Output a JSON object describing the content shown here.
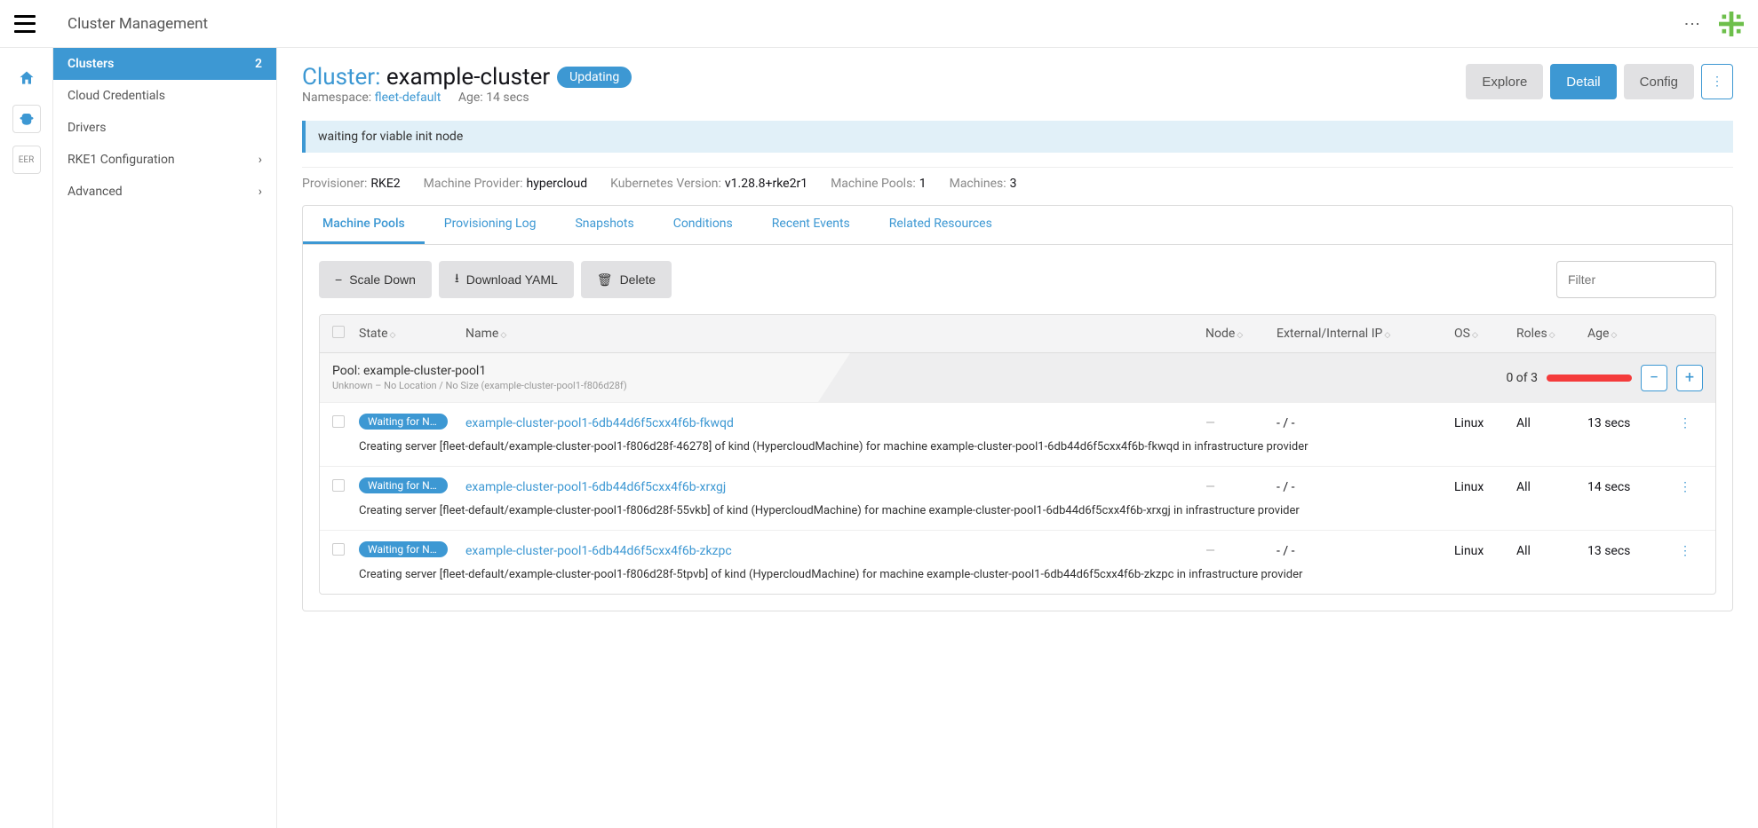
{
  "header": {
    "title": "Cluster Management"
  },
  "sidebar": {
    "items": [
      {
        "label": "Clusters",
        "count": "2",
        "active": true
      },
      {
        "label": "Cloud Credentials"
      },
      {
        "label": "Drivers"
      },
      {
        "label": "RKE1 Configuration",
        "expandable": true
      },
      {
        "label": "Advanced",
        "expandable": true
      }
    ]
  },
  "iconrail": {
    "text": "EER"
  },
  "cluster": {
    "prefix": "Cluster:",
    "name": "example-cluster",
    "status": "Updating",
    "ns_label": "Namespace:",
    "ns": "fleet-default",
    "age_label": "Age:",
    "age": "14 secs",
    "explore": "Explore",
    "detail": "Detail",
    "config": "Config",
    "banner": "waiting for viable init node"
  },
  "meta": {
    "provisioner_label": "Provisioner:",
    "provisioner": "RKE2",
    "machine_provider_label": "Machine Provider:",
    "machine_provider": "hypercloud",
    "k8s_label": "Kubernetes Version:",
    "k8s": "v1.28.8+rke2r1",
    "pools_label": "Machine Pools:",
    "pools": "1",
    "machines_label": "Machines:",
    "machines": "3"
  },
  "tabs": [
    "Machine Pools",
    "Provisioning Log",
    "Snapshots",
    "Conditions",
    "Recent Events",
    "Related Resources"
  ],
  "actions": {
    "scaledown": "Scale Down",
    "download": "Download YAML",
    "delete": "Delete",
    "filter_placeholder": "Filter"
  },
  "columns": {
    "state": "State",
    "name": "Name",
    "node": "Node",
    "ip": "External/Internal IP",
    "os": "OS",
    "roles": "Roles",
    "age": "Age"
  },
  "pool": {
    "name": "Pool: example-cluster-pool1",
    "sub": "Unknown – No Location / No Size (example-cluster-pool1-f806d28f)",
    "count": "0 of 3"
  },
  "rows": [
    {
      "state": "Waiting for No…",
      "name": "example-cluster-pool1-6db44d6f5cxx4f6b-fkwqd",
      "node": "—",
      "ip": "- / -",
      "os": "Linux",
      "roles": "All",
      "age": "13 secs",
      "msg": "Creating server [fleet-default/example-cluster-pool1-f806d28f-46278] of kind (HypercloudMachine) for machine example-cluster-pool1-6db44d6f5cxx4f6b-fkwqd in infrastructure provider"
    },
    {
      "state": "Waiting for No…",
      "name": "example-cluster-pool1-6db44d6f5cxx4f6b-xrxgj",
      "node": "—",
      "ip": "- / -",
      "os": "Linux",
      "roles": "All",
      "age": "14 secs",
      "msg": "Creating server [fleet-default/example-cluster-pool1-f806d28f-55vkb] of kind (HypercloudMachine) for machine example-cluster-pool1-6db44d6f5cxx4f6b-xrxgj in infrastructure provider"
    },
    {
      "state": "Waiting for No…",
      "name": "example-cluster-pool1-6db44d6f5cxx4f6b-zkzpc",
      "node": "—",
      "ip": "- / -",
      "os": "Linux",
      "roles": "All",
      "age": "13 secs",
      "msg": "Creating server [fleet-default/example-cluster-pool1-f806d28f-5tpvb] of kind (HypercloudMachine) for machine example-cluster-pool1-6db44d6f5cxx4f6b-zkzpc in infrastructure provider"
    }
  ]
}
